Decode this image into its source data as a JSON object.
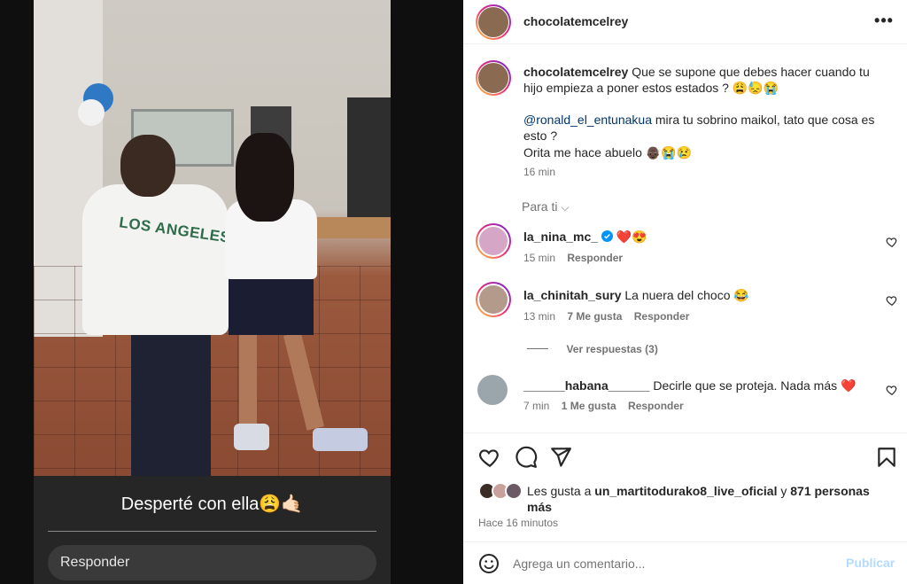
{
  "story": {
    "shirt_text": "LOS ANGELES",
    "caption": "Desperté con ella😩🤙🏻",
    "reply_placeholder": "Responder"
  },
  "header": {
    "username": "chocolatemcelrey",
    "more_label": "•••"
  },
  "post": {
    "username": "chocolatemcelrey",
    "caption_line1": "Que se supone que debes hacer cuando tu hijo empieza a poner estos estados ? 😩😓😭",
    "mention": "@ronald_el_entunakua",
    "caption_line2": " mira tu sobrino maikol, tato que cosa es esto ?",
    "caption_line3": "Orita me hace abuelo 👴🏿😭😢",
    "time": "16 min"
  },
  "sort": {
    "label": "Para ti",
    "chevron": "⌵"
  },
  "comments": [
    {
      "username": "la_nina_mc_",
      "verified": true,
      "text": "❤️😍",
      "time": "15 min",
      "likes": "",
      "reply": "Responder",
      "avatar_color": "#d6a6c7"
    },
    {
      "username": "la_chinitah_sury",
      "verified": false,
      "text": "La nuera del choco 😂",
      "time": "13 min",
      "likes": "7 Me gusta",
      "reply": "Responder",
      "avatar_color": "#b39a8a"
    },
    {
      "username": "______habana______",
      "verified": false,
      "text": "Decirle que se proteja. Nada más ❤️",
      "time": "7 min",
      "likes": "1 Me gusta",
      "reply": "Responder",
      "avatar_color": "#9aa5ac"
    }
  ],
  "view_replies": "Ver respuestas (3)",
  "likes": {
    "prefix": "Les gusta a ",
    "user": "un_martitodurako8_live_oficial",
    "middle": " y ",
    "count": "871 personas",
    "suffix": "más"
  },
  "post_age": "Hace 16 minutos",
  "add_comment": {
    "placeholder": "Agrega un comentario...",
    "publish": "Publicar"
  },
  "colors": {
    "verified": "#0095f6",
    "heart_red": "#ed4956",
    "publish_disabled": "#b3dbff"
  }
}
